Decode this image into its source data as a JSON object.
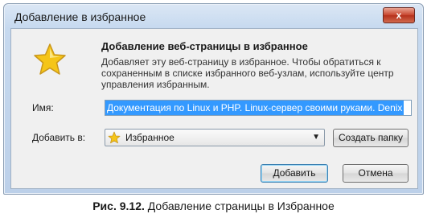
{
  "window": {
    "title": "Добавление в избранное",
    "close_glyph": "x"
  },
  "header": {
    "heading": "Добавление веб-страницы в избранное",
    "description": "Добавляет эту веб-страницу в избранное. Чтобы обратиться к сохраненным в списке избранного веб-узлам, используйте центр управления избранным."
  },
  "form": {
    "name_label": "Имя:",
    "name_value": "Документация по Linux и PHP. Linux-сервер своими руками. Denix",
    "add_to_label": "Добавить в:",
    "folder_value": "Избранное",
    "create_folder_label": "Создать папку"
  },
  "buttons": {
    "add_label": "Добавить",
    "cancel_label": "Отмена"
  },
  "caption": {
    "number": "Рис. 9.12.",
    "text": " Добавление страницы в Избранное"
  },
  "icons": {
    "favorites": "star-icon",
    "dropdown": "chevron-down-icon",
    "close": "close-icon"
  },
  "colors": {
    "star": "#f5c518",
    "selection": "#3399ff",
    "close": "#c7432c"
  }
}
